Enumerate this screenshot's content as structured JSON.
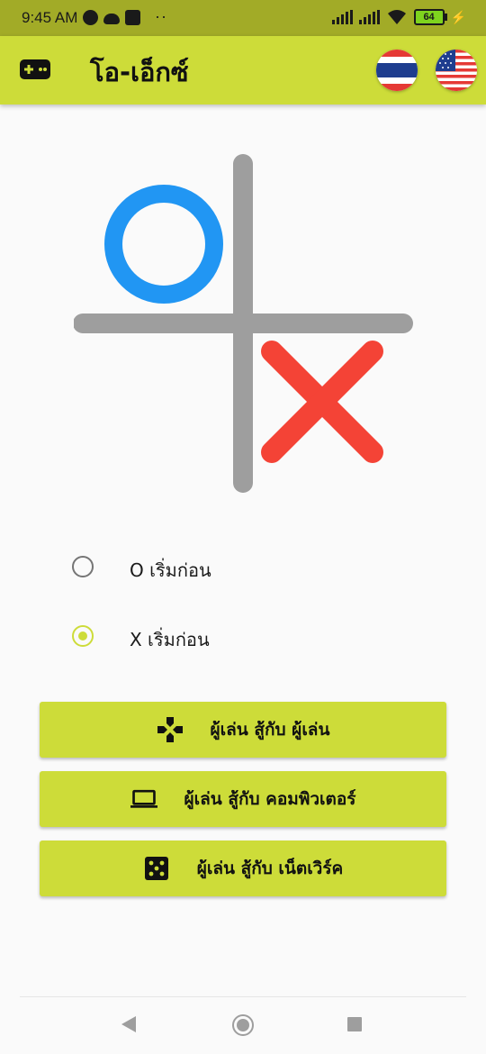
{
  "status_bar": {
    "time": "9:45 AM",
    "dots": "··",
    "battery": "64",
    "left_icons": [
      "notification-icon",
      "cloud-icon",
      "m-icon"
    ],
    "right_icons": [
      "signal-icon",
      "signal-icon",
      "wifi-icon",
      "battery-icon",
      "charging-icon"
    ]
  },
  "app_bar": {
    "title": "โอ-เอ็กซ์",
    "nav_icon": "gamepad-icon",
    "languages": [
      "Thai flag",
      "US flag"
    ]
  },
  "board": {
    "o_color": "#2196f3",
    "x_color": "#f44336",
    "grid_color": "#9e9e9e"
  },
  "radio_options": [
    {
      "label": "O เริ่มก่อน",
      "checked": false
    },
    {
      "label": "X เริ่มก่อน",
      "checked": true
    }
  ],
  "buttons": [
    {
      "label": "ผู้เล่น สู้กับ ผู้เล่น",
      "icon": "gamepad-cross-icon"
    },
    {
      "label": "ผู้เล่น สู้กับ คอมพิวเตอร์",
      "icon": "laptop-icon"
    },
    {
      "label": "ผู้เล่น สู้กับ เน็ตเวิร์ค",
      "icon": "dice-icon"
    }
  ],
  "colors": {
    "accent": "#cddc39",
    "status_bar": "#a2ab27",
    "background": "#fafafa"
  }
}
